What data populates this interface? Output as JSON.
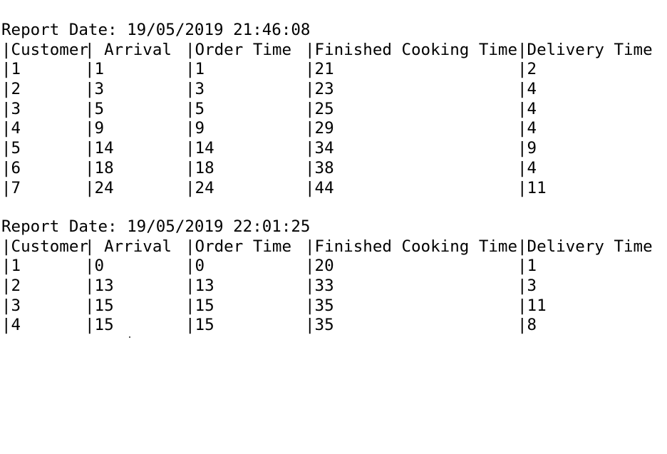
{
  "reports": [
    {
      "title": "Report Date: 19/05/2019 21:46:08",
      "header": [
        "|Customer",
        "| Arrival",
        "|Order Time",
        "|Finished Cooking Time",
        "|Delivery Time"
      ],
      "rows": [
        [
          "|1",
          "|1",
          "|1",
          "|21",
          "|2"
        ],
        [
          "|2",
          "|3",
          "|3",
          "|23",
          "|4"
        ],
        [
          "|3",
          "|5",
          "|5",
          "|25",
          "|4"
        ],
        [
          "|4",
          "|9",
          "|9",
          "|29",
          "|4"
        ],
        [
          "|5",
          "|14",
          "|14",
          "|34",
          "|9"
        ],
        [
          "|6",
          "|18",
          "|18",
          "|38",
          "|4"
        ],
        [
          "|7",
          "|24",
          "|24",
          "|44",
          "|11"
        ]
      ]
    },
    {
      "title": "Report Date: 19/05/2019 22:01:25",
      "header": [
        "|Customer",
        "| Arrival",
        "|Order Time",
        "|Finished Cooking Time",
        "|Delivery Time"
      ],
      "rows": [
        [
          "|1",
          "|0",
          "|0",
          "|20",
          "|1"
        ],
        [
          "|2",
          "|13",
          "|13",
          "|33",
          "|3"
        ],
        [
          "|3",
          "|15",
          "|15",
          "|35",
          "|11"
        ],
        [
          "|4",
          "|15",
          "|15",
          "|35",
          "|8"
        ]
      ]
    }
  ]
}
